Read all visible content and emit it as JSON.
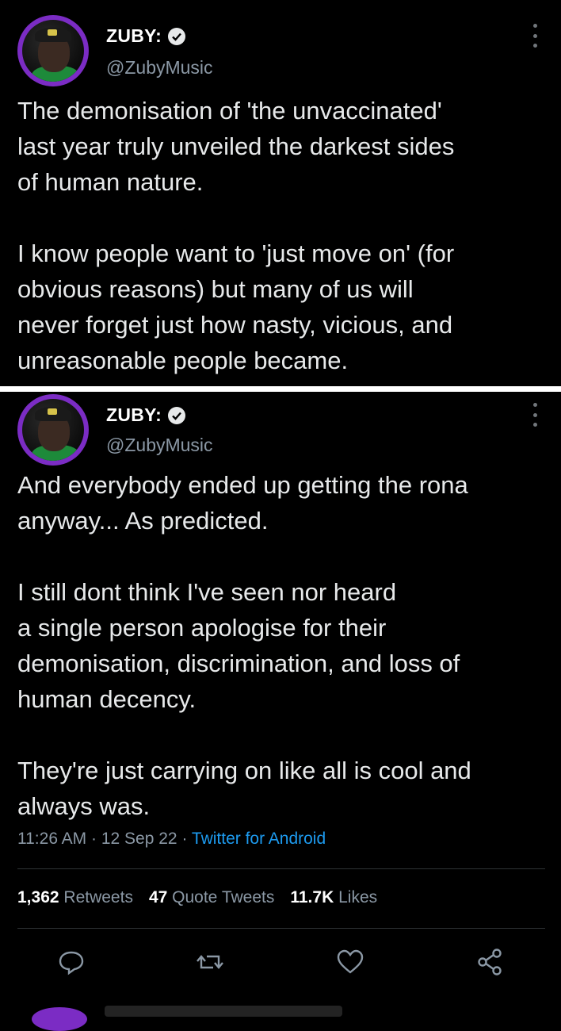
{
  "tweets": [
    {
      "author_name": "ZUBY:",
      "handle": "@ZubyMusic",
      "text": "The demonisation of 'the unvaccinated'\nlast year truly unveiled the darkest sides\nof human nature.\n\nI know people want to 'just move on' (for\nobvious reasons) but many of us will\nnever forget just how nasty, vicious, and\nunreasonable people became."
    },
    {
      "author_name": "ZUBY:",
      "handle": "@ZubyMusic",
      "text": "And everybody ended up getting the rona\nanyway... As predicted.\n\nI still dont think I've seen nor heard\na single person apologise for their\ndemonisation, discrimination, and loss of\nhuman decency.\n\nThey're just carrying on like all is cool and\nalways was.",
      "time": "11:26 AM",
      "date": "12 Sep 22",
      "source": "Twitter for Android",
      "stats": {
        "retweets_count": "1,362",
        "retweets_label": "Retweets",
        "quotes_count": "47",
        "quotes_label": "Quote Tweets",
        "likes_count": "11.7K",
        "likes_label": "Likes"
      }
    }
  ],
  "icons": [
    "verified-badge-icon",
    "more-icon",
    "reply-icon",
    "retweet-icon",
    "like-icon",
    "share-icon"
  ],
  "colors": {
    "background": "#000000",
    "text": "#e7e9ea",
    "muted": "#8b98a5",
    "link": "#1d9bf0",
    "avatar_ring": "#7b2cc4"
  }
}
